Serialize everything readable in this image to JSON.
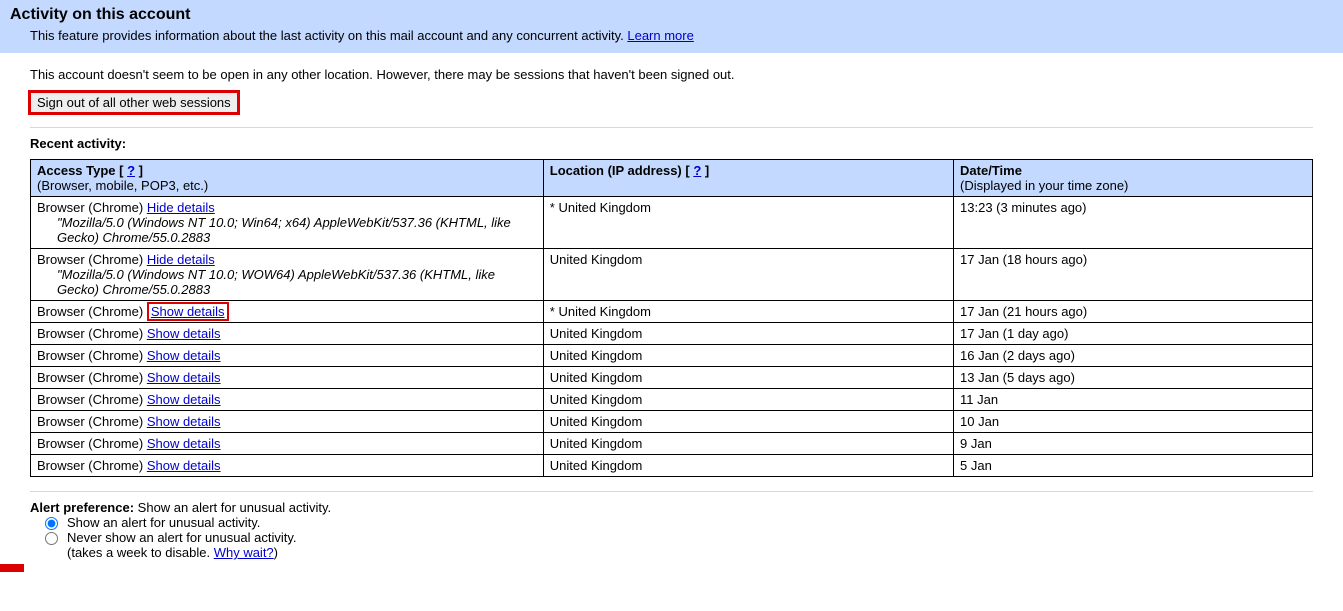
{
  "header": {
    "title": "Activity on this account",
    "description": "This feature provides information about the last activity on this mail account and any concurrent activity.",
    "learn_more": "Learn more"
  },
  "status": "This account doesn't seem to be open in any other location. However, there may be sessions that haven't been signed out.",
  "signout_button": "Sign out of all other web sessions",
  "recent_activity_label": "Recent activity:",
  "table_headers": {
    "access_type": "Access Type",
    "access_type_sub": "(Browser, mobile, POP3, etc.)",
    "location": "Location (IP address)",
    "date": "Date/Time",
    "date_sub": "(Displayed in your time zone)",
    "help": "?"
  },
  "details_labels": {
    "hide": "Hide details",
    "show": "Show details"
  },
  "rows": [
    {
      "browser": "Browser (Chrome)",
      "toggle": "hide",
      "ua": "\"Mozilla/5.0 (Windows NT 10.0; Win64; x64) AppleWebKit/537.36 (KHTML, like Gecko) Chrome/55.0.2883",
      "location": "* United Kingdom",
      "date": "13:23 (3 minutes ago)",
      "highlight": false
    },
    {
      "browser": "Browser (Chrome)",
      "toggle": "hide",
      "ua": "\"Mozilla/5.0 (Windows NT 10.0; WOW64) AppleWebKit/537.36 (KHTML, like Gecko) Chrome/55.0.2883",
      "location": "United Kingdom",
      "date": "17 Jan (18 hours ago)",
      "highlight": false
    },
    {
      "browser": "Browser (Chrome)",
      "toggle": "show",
      "ua": "",
      "location": "* United Kingdom",
      "date": "17 Jan (21 hours ago)",
      "highlight": true
    },
    {
      "browser": "Browser (Chrome)",
      "toggle": "show",
      "ua": "",
      "location": "United Kingdom",
      "date": "17 Jan (1 day ago)",
      "highlight": false
    },
    {
      "browser": "Browser (Chrome)",
      "toggle": "show",
      "ua": "",
      "location": "United Kingdom",
      "date": "16 Jan (2 days ago)",
      "highlight": false
    },
    {
      "browser": "Browser (Chrome)",
      "toggle": "show",
      "ua": "",
      "location": "United Kingdom",
      "date": "13 Jan (5 days ago)",
      "highlight": false
    },
    {
      "browser": "Browser (Chrome)",
      "toggle": "show",
      "ua": "",
      "location": "United Kingdom",
      "date": "11 Jan",
      "highlight": false
    },
    {
      "browser": "Browser (Chrome)",
      "toggle": "show",
      "ua": "",
      "location": "United Kingdom",
      "date": "10 Jan",
      "highlight": false
    },
    {
      "browser": "Browser (Chrome)",
      "toggle": "show",
      "ua": "",
      "location": "United Kingdom",
      "date": "9 Jan",
      "highlight": false
    },
    {
      "browser": "Browser (Chrome)",
      "toggle": "show",
      "ua": "",
      "location": "United Kingdom",
      "date": "5 Jan",
      "highlight": false
    }
  ],
  "alert": {
    "label": "Alert preference:",
    "current": "Show an alert for unusual activity.",
    "opt_show": "Show an alert for unusual activity.",
    "opt_never": "Never show an alert for unusual activity.",
    "opt_never_sub": "(takes a week to disable. ",
    "why_wait": "Why wait?",
    "close_paren": ")"
  }
}
